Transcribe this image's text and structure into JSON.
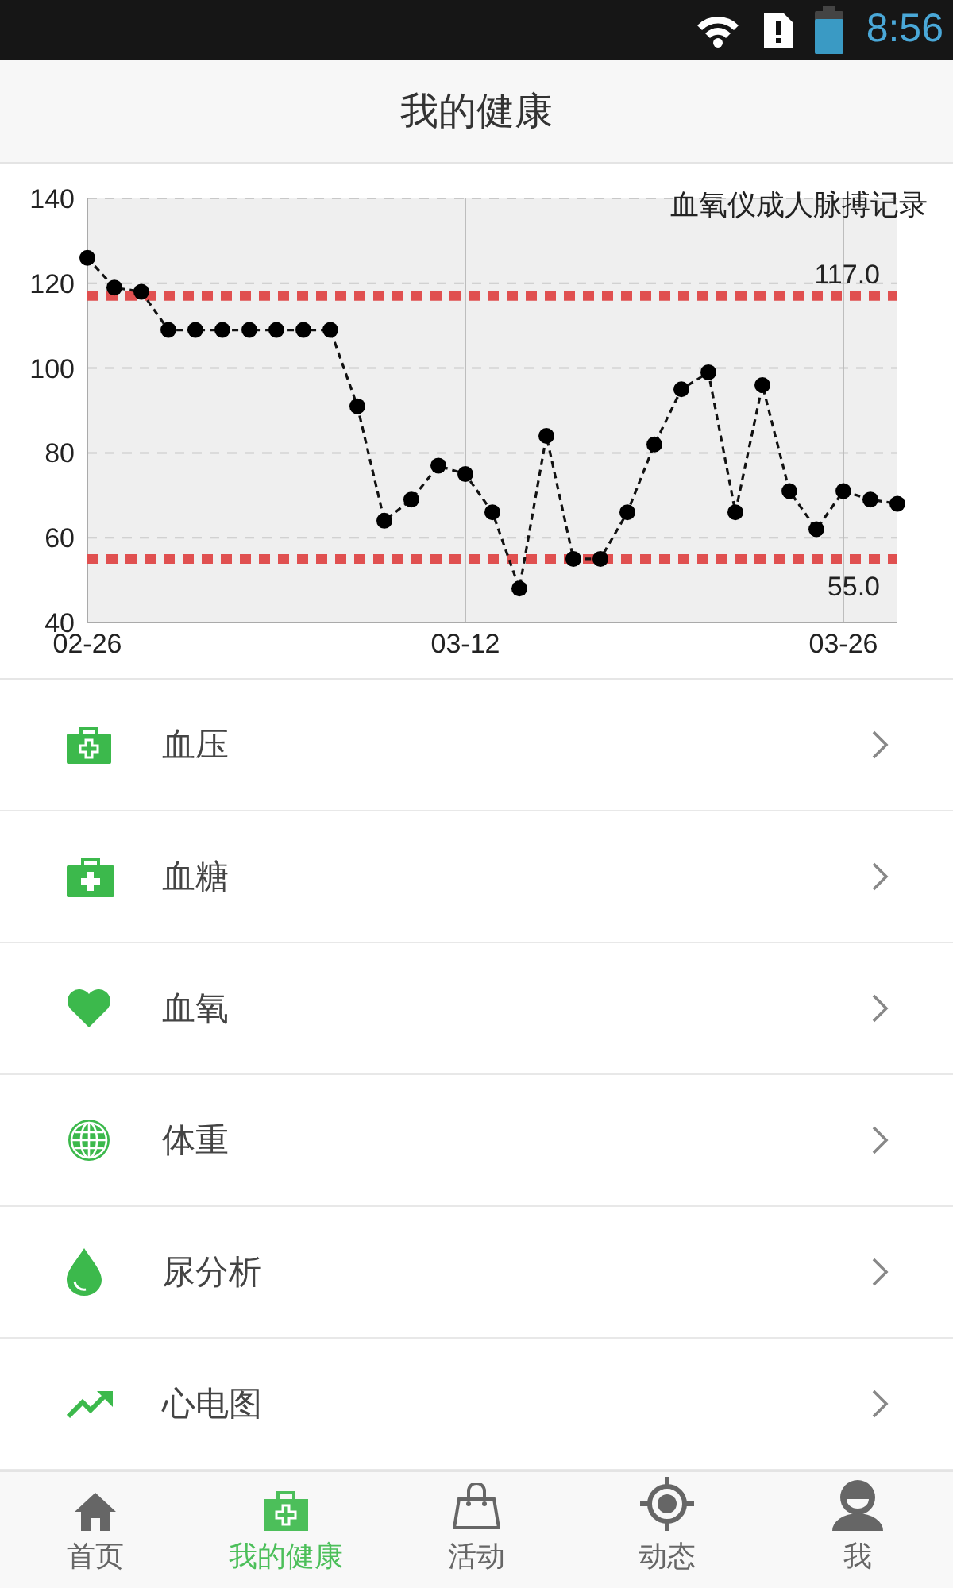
{
  "status_bar": {
    "time": "8:56"
  },
  "header": {
    "title": "我的健康"
  },
  "chart": {
    "chart_data": {
      "type": "line",
      "title": "血氧仪成人脉搏记录",
      "categories": [
        "02-26",
        null,
        null,
        null,
        null,
        null,
        null,
        null,
        null,
        null,
        null,
        null,
        null,
        null,
        "03-12",
        null,
        null,
        null,
        null,
        null,
        null,
        null,
        null,
        null,
        null,
        null,
        null,
        null,
        "03-26",
        null,
        null
      ],
      "values": [
        126,
        119,
        118,
        109,
        109,
        109,
        109,
        109,
        109,
        109,
        91,
        64,
        69,
        77,
        75,
        66,
        48,
        84,
        55,
        55,
        66,
        82,
        95,
        99,
        66,
        96,
        71,
        62,
        71,
        69,
        68
      ],
      "ylim": [
        40,
        140
      ],
      "yticks": [
        40,
        60,
        80,
        100,
        120,
        140
      ],
      "grid": true,
      "line_style": "dashed",
      "marker": "o",
      "ref_lines": [
        {
          "axis": "y",
          "value": 117,
          "label": "117.0",
          "color": "#e05050"
        },
        {
          "axis": "y",
          "value": 55,
          "label": "55.0",
          "color": "#e05050"
        }
      ]
    }
  },
  "items": [
    {
      "kind": "kit-outline",
      "label": "血压"
    },
    {
      "kind": "kit",
      "label": "血糖"
    },
    {
      "kind": "heart",
      "label": "血氧"
    },
    {
      "kind": "globe",
      "label": "体重"
    },
    {
      "kind": "drop",
      "label": "尿分析"
    },
    {
      "kind": "trend",
      "label": "心电图"
    }
  ],
  "tabs": [
    {
      "kind": "home",
      "label": "首页",
      "selected": false
    },
    {
      "kind": "kit",
      "label": "我的健康",
      "selected": true
    },
    {
      "kind": "bag",
      "label": "活动",
      "selected": false
    },
    {
      "kind": "target",
      "label": "动态",
      "selected": false
    },
    {
      "kind": "person",
      "label": "我",
      "selected": false
    }
  ]
}
